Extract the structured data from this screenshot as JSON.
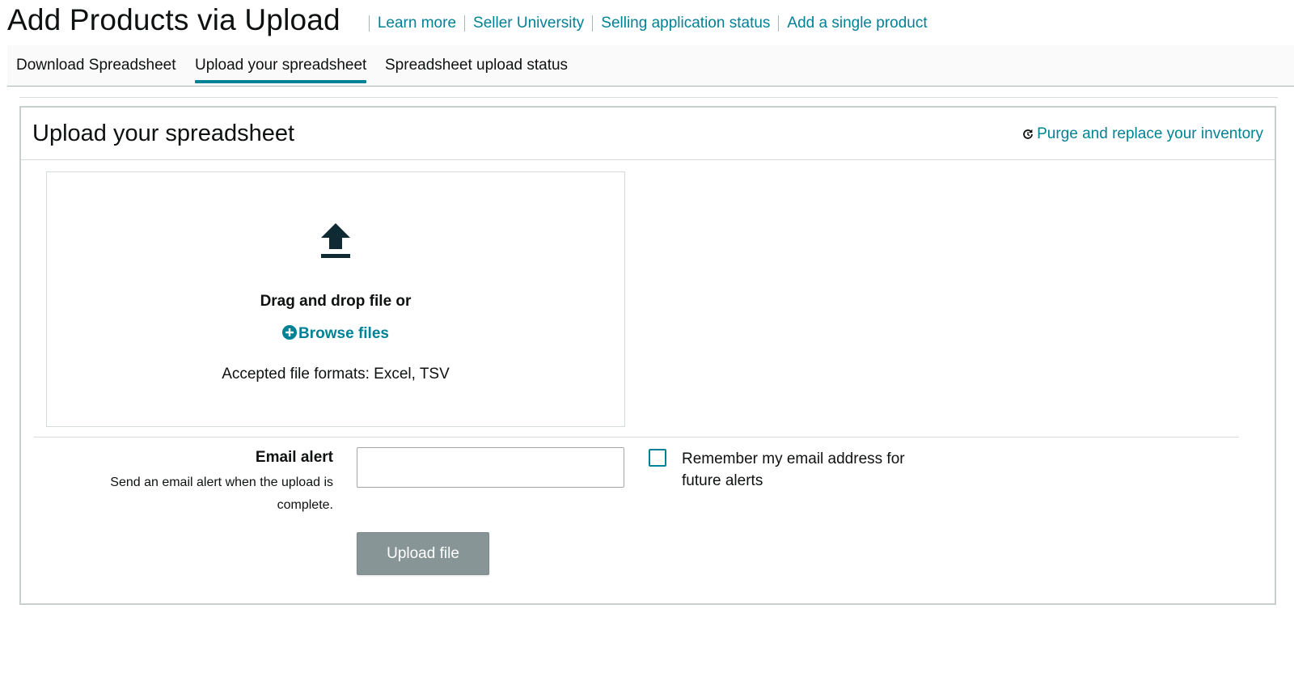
{
  "header": {
    "title": "Add Products via Upload",
    "links": [
      "Learn more",
      "Seller University",
      "Selling application status",
      "Add a single product"
    ]
  },
  "tabs": [
    {
      "label": "Download Spreadsheet",
      "active": false
    },
    {
      "label": "Upload your spreadsheet",
      "active": true
    },
    {
      "label": "Spreadsheet upload status",
      "active": false
    }
  ],
  "panel": {
    "title": "Upload your spreadsheet",
    "purge_link": "Purge and replace your inventory",
    "purge_icon": "refresh-icon"
  },
  "dropzone": {
    "icon": "upload-arrow-icon",
    "drag_text": "Drag and drop file or",
    "browse_label": "Browse files",
    "browse_icon": "plus-circle-icon",
    "formats": "Accepted file formats: Excel, TSV"
  },
  "email": {
    "label": "Email alert",
    "help": "Send an email alert when the upload is complete.",
    "value": "",
    "remember_label": "Remember my email address for future alerts",
    "remember_checked": false
  },
  "upload_button": "Upload file",
  "colors": {
    "accent": "#008296",
    "button_disabled": "#879596",
    "text": "#0f1111"
  }
}
